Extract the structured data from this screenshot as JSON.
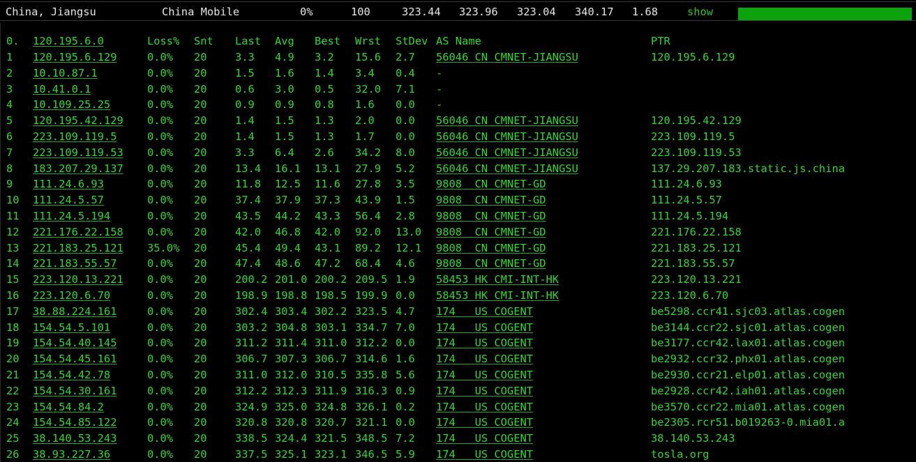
{
  "summary": {
    "location": "China, Jiangsu",
    "isp": "China Mobile",
    "loss": "0%",
    "sent": "100",
    "last": "323.44",
    "avg": "323.96",
    "best": "323.04",
    "worst": "340.17",
    "stdev": "1.68",
    "show_label": "show",
    "bar_fraction": 1.0
  },
  "headers": {
    "num": "0.",
    "host": "120.195.6.0",
    "loss": "Loss%",
    "snt": "Snt",
    "last": "Last",
    "avg": "Avg",
    "best": "Best",
    "wrst": "Wrst",
    "stdev": "StDev",
    "asname": "AS Name",
    "ptr": "PTR"
  },
  "hops": [
    {
      "num": "1",
      "host": "120.195.6.129",
      "loss": "0.0%",
      "snt": "20",
      "last": "3.3",
      "avg": "4.9",
      "best": "3.2",
      "wrst": "15.6",
      "stdev": "2.7",
      "asname": "56046 CN CMNET-JIANGSU",
      "ptr": "120.195.6.129"
    },
    {
      "num": "2",
      "host": "10.10.87.1",
      "loss": "0.0%",
      "snt": "20",
      "last": "1.5",
      "avg": "1.6",
      "best": "1.4",
      "wrst": "3.4",
      "stdev": "0.4",
      "asname": "-",
      "ptr": ""
    },
    {
      "num": "3",
      "host": "10.41.0.1",
      "loss": "0.0%",
      "snt": "20",
      "last": "0.6",
      "avg": "3.0",
      "best": "0.5",
      "wrst": "32.0",
      "stdev": "7.1",
      "asname": "-",
      "ptr": ""
    },
    {
      "num": "4",
      "host": "10.109.25.25",
      "loss": "0.0%",
      "snt": "20",
      "last": "0.9",
      "avg": "0.9",
      "best": "0.8",
      "wrst": "1.6",
      "stdev": "0.0",
      "asname": "-",
      "ptr": ""
    },
    {
      "num": "5",
      "host": "120.195.42.129",
      "loss": "0.0%",
      "snt": "20",
      "last": "1.4",
      "avg": "1.5",
      "best": "1.3",
      "wrst": "2.0",
      "stdev": "0.0",
      "asname": "56046 CN CMNET-JIANGSU",
      "ptr": "120.195.42.129"
    },
    {
      "num": "6",
      "host": "223.109.119.5",
      "loss": "0.0%",
      "snt": "20",
      "last": "1.4",
      "avg": "1.5",
      "best": "1.3",
      "wrst": "1.7",
      "stdev": "0.0",
      "asname": "56046 CN CMNET-JIANGSU",
      "ptr": "223.109.119.5"
    },
    {
      "num": "7",
      "host": "223.109.119.53",
      "loss": "0.0%",
      "snt": "20",
      "last": "3.3",
      "avg": "6.4",
      "best": "2.6",
      "wrst": "34.2",
      "stdev": "8.0",
      "asname": "56046 CN CMNET-JIANGSU",
      "ptr": "223.109.119.53"
    },
    {
      "num": "8",
      "host": "183.207.29.137",
      "loss": "0.0%",
      "snt": "20",
      "last": "13.4",
      "avg": "16.1",
      "best": "13.1",
      "wrst": "27.9",
      "stdev": "5.2",
      "asname": "56046 CN CMNET-JIANGSU",
      "ptr": "137.29.207.183.static.js.china"
    },
    {
      "num": "9",
      "host": "111.24.6.93",
      "loss": "0.0%",
      "snt": "20",
      "last": "11.8",
      "avg": "12.5",
      "best": "11.6",
      "wrst": "27.8",
      "stdev": "3.5",
      "asname": "9808  CN CMNET-GD",
      "ptr": "111.24.6.93"
    },
    {
      "num": "10",
      "host": "111.24.5.57",
      "loss": "0.0%",
      "snt": "20",
      "last": "37.4",
      "avg": "37.9",
      "best": "37.3",
      "wrst": "43.9",
      "stdev": "1.5",
      "asname": "9808  CN CMNET-GD",
      "ptr": "111.24.5.57"
    },
    {
      "num": "11",
      "host": "111.24.5.194",
      "loss": "0.0%",
      "snt": "20",
      "last": "43.5",
      "avg": "44.2",
      "best": "43.3",
      "wrst": "56.4",
      "stdev": "2.8",
      "asname": "9808  CN CMNET-GD",
      "ptr": "111.24.5.194"
    },
    {
      "num": "12",
      "host": "221.176.22.158",
      "loss": "0.0%",
      "snt": "20",
      "last": "42.0",
      "avg": "46.8",
      "best": "42.0",
      "wrst": "92.0",
      "stdev": "13.0",
      "asname": "9808  CN CMNET-GD",
      "ptr": "221.176.22.158"
    },
    {
      "num": "13",
      "host": "221.183.25.121",
      "loss": "35.0%",
      "snt": "20",
      "last": "45.4",
      "avg": "49.4",
      "best": "43.1",
      "wrst": "89.2",
      "stdev": "12.1",
      "asname": "9808  CN CMNET-GD",
      "ptr": "221.183.25.121"
    },
    {
      "num": "14",
      "host": "221.183.55.57",
      "loss": "0.0%",
      "snt": "20",
      "last": "47.4",
      "avg": "48.6",
      "best": "47.2",
      "wrst": "68.4",
      "stdev": "4.6",
      "asname": "9808  CN CMNET-GD",
      "ptr": "221.183.55.57"
    },
    {
      "num": "15",
      "host": "223.120.13.221",
      "loss": "0.0%",
      "snt": "20",
      "last": "200.2",
      "avg": "201.0",
      "best": "200.2",
      "wrst": "209.5",
      "stdev": "1.9",
      "asname": "58453 HK CMI-INT-HK",
      "ptr": "223.120.13.221"
    },
    {
      "num": "16",
      "host": "223.120.6.70",
      "loss": "0.0%",
      "snt": "20",
      "last": "198.9",
      "avg": "198.8",
      "best": "198.5",
      "wrst": "199.9",
      "stdev": "0.0",
      "asname": "58453 HK CMI-INT-HK",
      "ptr": "223.120.6.70"
    },
    {
      "num": "17",
      "host": "38.88.224.161",
      "loss": "0.0%",
      "snt": "20",
      "last": "302.4",
      "avg": "303.4",
      "best": "302.2",
      "wrst": "323.5",
      "stdev": "4.7",
      "asname": "174   US COGENT",
      "ptr": "be5298.ccr41.sjc03.atlas.cogen"
    },
    {
      "num": "18",
      "host": "154.54.5.101",
      "loss": "0.0%",
      "snt": "20",
      "last": "303.2",
      "avg": "304.8",
      "best": "303.1",
      "wrst": "334.7",
      "stdev": "7.0",
      "asname": "174   US COGENT",
      "ptr": "be3144.ccr22.sjc01.atlas.cogen"
    },
    {
      "num": "19",
      "host": "154.54.40.145",
      "loss": "0.0%",
      "snt": "20",
      "last": "311.2",
      "avg": "311.4",
      "best": "311.0",
      "wrst": "312.2",
      "stdev": "0.0",
      "asname": "174   US COGENT",
      "ptr": "be3177.ccr42.lax01.atlas.cogen"
    },
    {
      "num": "20",
      "host": "154.54.45.161",
      "loss": "0.0%",
      "snt": "20",
      "last": "306.7",
      "avg": "307.3",
      "best": "306.7",
      "wrst": "314.6",
      "stdev": "1.6",
      "asname": "174   US COGENT",
      "ptr": "be2932.ccr32.phx01.atlas.cogen"
    },
    {
      "num": "21",
      "host": "154.54.42.78",
      "loss": "0.0%",
      "snt": "20",
      "last": "311.0",
      "avg": "312.0",
      "best": "310.5",
      "wrst": "335.8",
      "stdev": "5.6",
      "asname": "174   US COGENT",
      "ptr": "be2930.ccr21.elp01.atlas.cogen"
    },
    {
      "num": "22",
      "host": "154.54.30.161",
      "loss": "0.0%",
      "snt": "20",
      "last": "312.2",
      "avg": "312.3",
      "best": "311.9",
      "wrst": "316.3",
      "stdev": "0.9",
      "asname": "174   US COGENT",
      "ptr": "be2928.ccr42.iah01.atlas.cogen"
    },
    {
      "num": "23",
      "host": "154.54.84.2",
      "loss": "0.0%",
      "snt": "20",
      "last": "324.9",
      "avg": "325.0",
      "best": "324.8",
      "wrst": "326.1",
      "stdev": "0.2",
      "asname": "174   US COGENT",
      "ptr": "be3570.ccr22.mia01.atlas.cogen"
    },
    {
      "num": "24",
      "host": "154.54.85.122",
      "loss": "0.0%",
      "snt": "20",
      "last": "320.8",
      "avg": "320.8",
      "best": "320.7",
      "wrst": "321.1",
      "stdev": "0.0",
      "asname": "174   US COGENT",
      "ptr": "be2305.rcr51.b019263-0.mia01.a"
    },
    {
      "num": "25",
      "host": "38.140.53.243",
      "loss": "0.0%",
      "snt": "20",
      "last": "338.5",
      "avg": "324.4",
      "best": "321.5",
      "wrst": "348.5",
      "stdev": "7.2",
      "asname": "174   US COGENT",
      "ptr": "38.140.53.243"
    },
    {
      "num": "26",
      "host": "38.93.227.36",
      "loss": "0.0%",
      "snt": "20",
      "last": "337.5",
      "avg": "325.1",
      "best": "323.1",
      "wrst": "346.5",
      "stdev": "5.9",
      "asname": "174   US COGENT",
      "ptr": "tosla.org"
    }
  ]
}
